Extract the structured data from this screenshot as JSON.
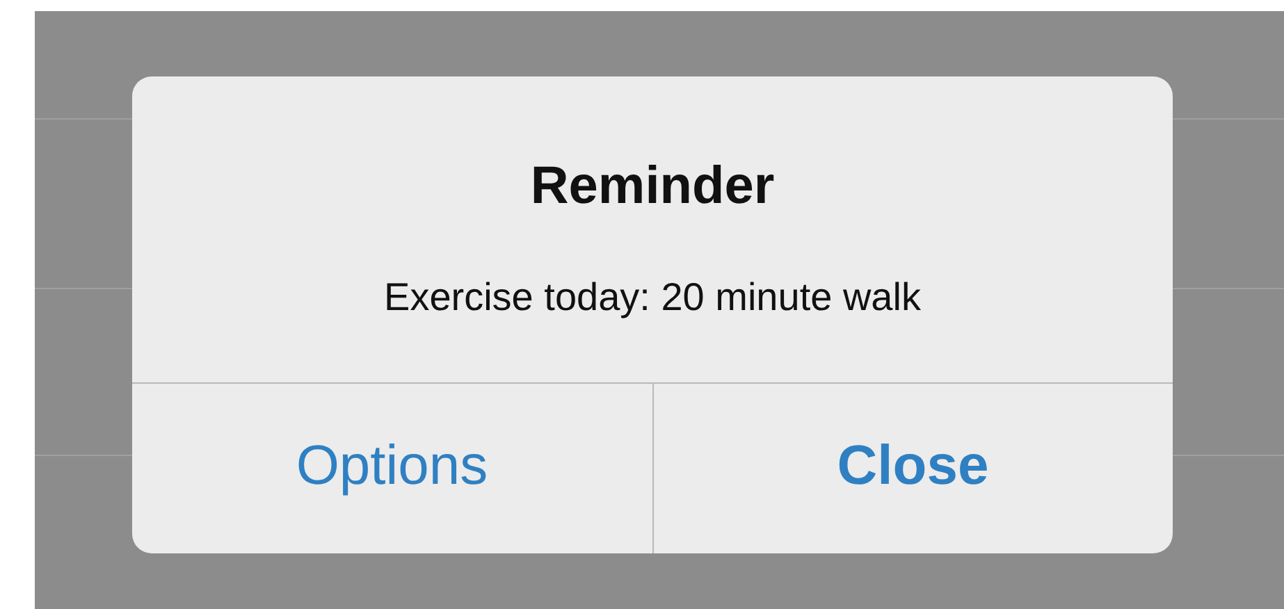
{
  "alert": {
    "title": "Reminder",
    "message": "Exercise today: 20 minute walk",
    "buttons": [
      {
        "label": "Options",
        "kind": "normal"
      },
      {
        "label": "Close",
        "kind": "default"
      }
    ]
  }
}
